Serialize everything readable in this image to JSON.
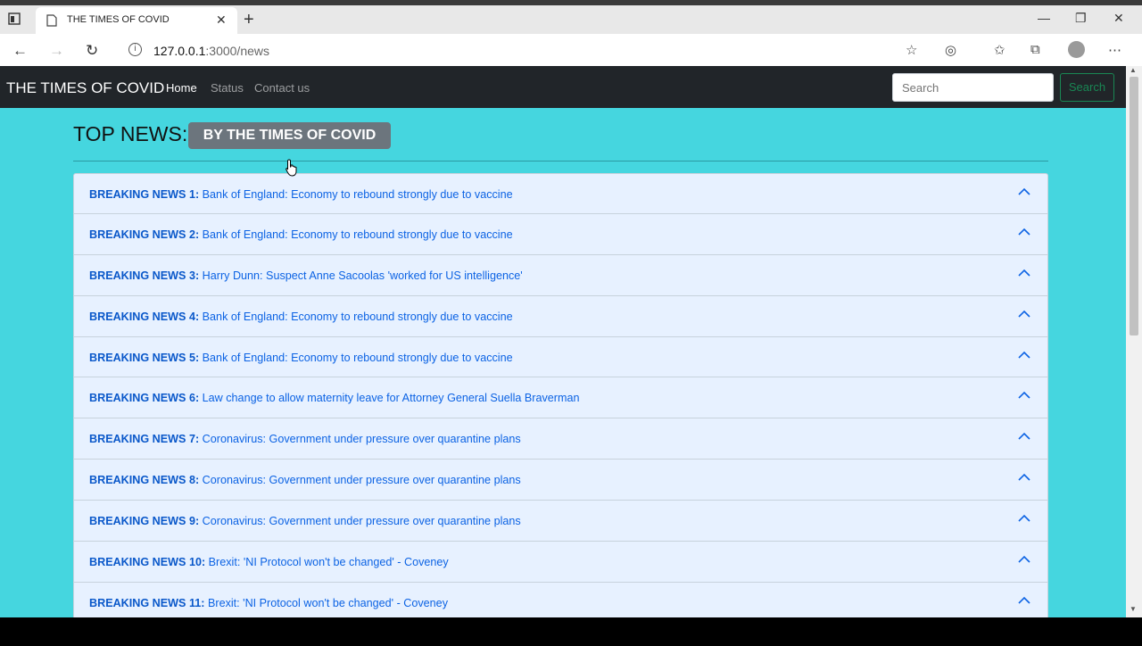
{
  "browser": {
    "tab_title": "THE TIMES OF COVID",
    "url_host": "127.0.0.1",
    "url_path": ":3000/news"
  },
  "navbar": {
    "brand": "THE TIMES OF COVID",
    "links": [
      "Home",
      "Status",
      "Contact us"
    ],
    "search_placeholder": "Search",
    "search_button": "Search"
  },
  "header": {
    "title": "TOP NEWS:",
    "badge": "BY THE TIMES OF COVID"
  },
  "news": [
    {
      "label": "BREAKING NEWS 1:",
      "headline": "Bank of England: Economy to rebound strongly due to vaccine"
    },
    {
      "label": "BREAKING NEWS 2:",
      "headline": "Bank of England: Economy to rebound strongly due to vaccine"
    },
    {
      "label": "BREAKING NEWS 3:",
      "headline": "Harry Dunn: Suspect Anne Sacoolas 'worked for US intelligence'"
    },
    {
      "label": "BREAKING NEWS 4:",
      "headline": "Bank of England: Economy to rebound strongly due to vaccine"
    },
    {
      "label": "BREAKING NEWS 5:",
      "headline": "Bank of England: Economy to rebound strongly due to vaccine"
    },
    {
      "label": "BREAKING NEWS 6:",
      "headline": "Law change to allow maternity leave for Attorney General Suella Braverman"
    },
    {
      "label": "BREAKING NEWS 7:",
      "headline": "Coronavirus: Government under pressure over quarantine plans"
    },
    {
      "label": "BREAKING NEWS 8:",
      "headline": "Coronavirus: Government under pressure over quarantine plans"
    },
    {
      "label": "BREAKING NEWS 9:",
      "headline": "Coronavirus: Government under pressure over quarantine plans"
    },
    {
      "label": "BREAKING NEWS 10:",
      "headline": "Brexit: 'NI Protocol won't be changed' - Coveney"
    },
    {
      "label": "BREAKING NEWS 11:",
      "headline": "Brexit: 'NI Protocol won't be changed' - Coveney"
    }
  ],
  "colors": {
    "page_background": "#45d6df",
    "navbar_background": "#212529",
    "accordion_background": "#e7f1ff",
    "link_blue": "#0c63e4",
    "search_green": "#198754",
    "badge_gray": "#6c757d"
  }
}
